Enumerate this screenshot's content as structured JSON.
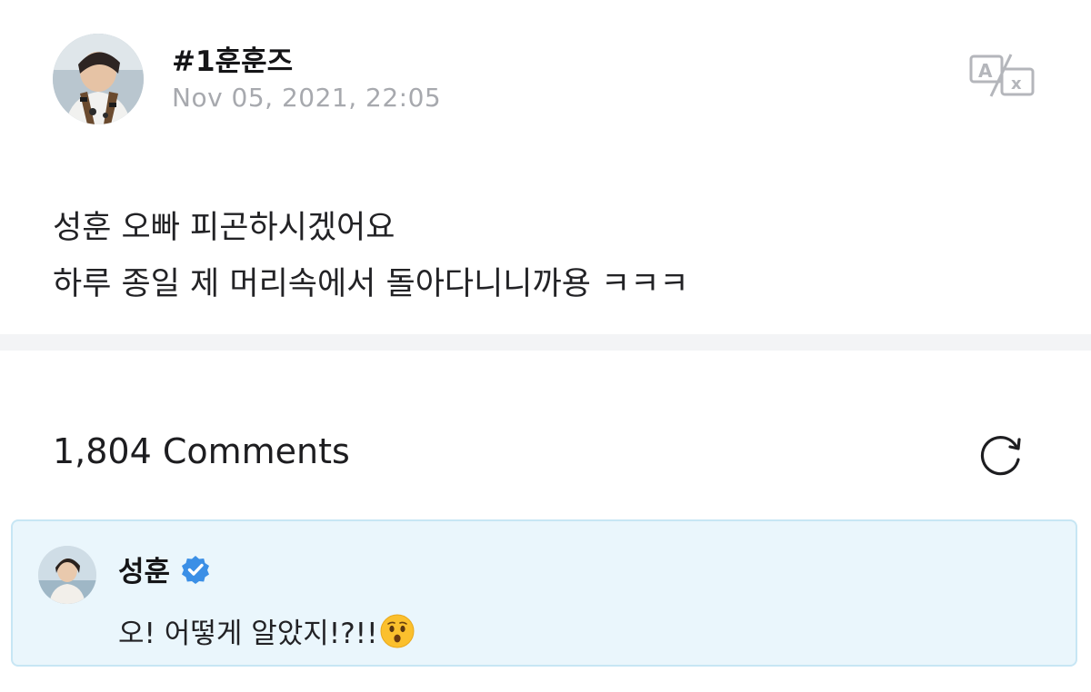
{
  "post": {
    "author": "#1훈훈즈",
    "timestamp": "Nov 05, 2021, 22:05",
    "body_lines": [
      "성훈 오빠 피곤하시겠어요",
      "하루 종일 제 머리속에서 돌아다니니까용 ㅋㅋㅋ"
    ],
    "translate_icon": "translate-icon"
  },
  "comments": {
    "count_label": "1,804 Comments",
    "refresh_icon": "refresh-icon",
    "highlighted": {
      "author": "성훈",
      "verified": true,
      "text": "오! 어떻게 알았지!?!!",
      "emoji": "hushed-face-emoji"
    }
  },
  "colors": {
    "accent_blue": "#3b8fe6",
    "card_bg": "#eaf6fc",
    "card_border": "#c7e6f4",
    "timestamp_gray": "#a7a9ae",
    "divider": "#f3f4f6"
  }
}
